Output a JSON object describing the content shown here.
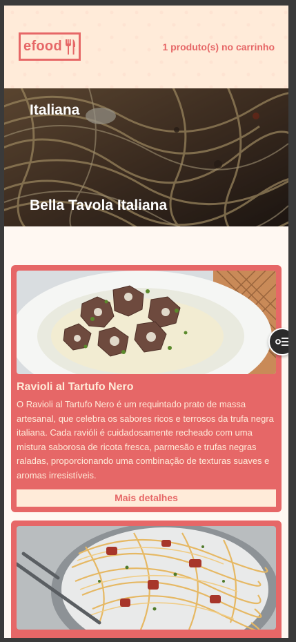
{
  "header": {
    "logo_text": "efood",
    "logo_icon": "fork-knife-icon",
    "cart_text": "1 produto(s) no carrinho"
  },
  "hero": {
    "category": "Italiana",
    "restaurant_name": "Bella Tavola Italiana"
  },
  "products": [
    {
      "title": "Ravioli al Tartufo Nero",
      "description": "O Ravioli al Tartufo Nero é um requintado prato de massa artesanal, que celebra os sabores ricos e terrosos da trufa negra italiana. Cada ravióli é cuidadosamente recheado com uma mistura saborosa de ricota fresca, parmesão e trufas negras raladas, proporcionando uma combinação de texturas suaves e aromas irresistíveis.",
      "button_label": "Mais detalhes"
    }
  ],
  "colors": {
    "primary": "#E66767",
    "header_bg": "#FFEBD9",
    "page_bg": "#FFF8F2"
  }
}
